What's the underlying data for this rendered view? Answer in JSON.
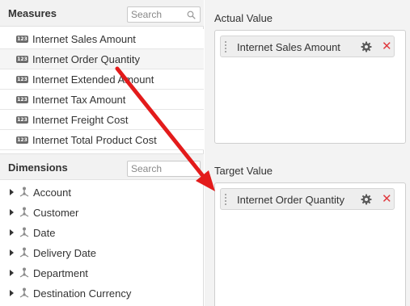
{
  "measures": {
    "title": "Measures",
    "search_placeholder": "Search",
    "items": [
      {
        "label": "Internet Sales Amount",
        "icon": "123"
      },
      {
        "label": "Internet Order Quantity",
        "icon": "123"
      },
      {
        "label": "Internet Extended Amount",
        "icon": "123"
      },
      {
        "label": "Internet Tax Amount",
        "icon": "123"
      },
      {
        "label": "Internet Freight Cost",
        "icon": "123"
      },
      {
        "label": "Internet Total Product Cost",
        "icon": "123"
      }
    ]
  },
  "dimensions": {
    "title": "Dimensions",
    "search_placeholder": "Search",
    "items": [
      {
        "label": "Account"
      },
      {
        "label": "Customer"
      },
      {
        "label": "Date"
      },
      {
        "label": "Delivery Date"
      },
      {
        "label": "Department"
      },
      {
        "label": "Destination Currency"
      }
    ]
  },
  "actual_value": {
    "title": "Actual Value",
    "chip_label": "Internet Sales Amount"
  },
  "target_value": {
    "title": "Target Value",
    "chip_label": "Internet Order Quantity"
  },
  "colors": {
    "arrow": "#e31b1b",
    "remove": "#e0393e",
    "panel_bg": "#f3f3f3",
    "header_bg": "#f2f2f2"
  },
  "icons": {
    "search": "search-icon",
    "measure": "number-icon",
    "dimension": "hierarchy-icon",
    "settings": "gear-icon",
    "remove": "close-icon",
    "expand": "caret-right-icon",
    "drag": "drag-handle-icon"
  }
}
